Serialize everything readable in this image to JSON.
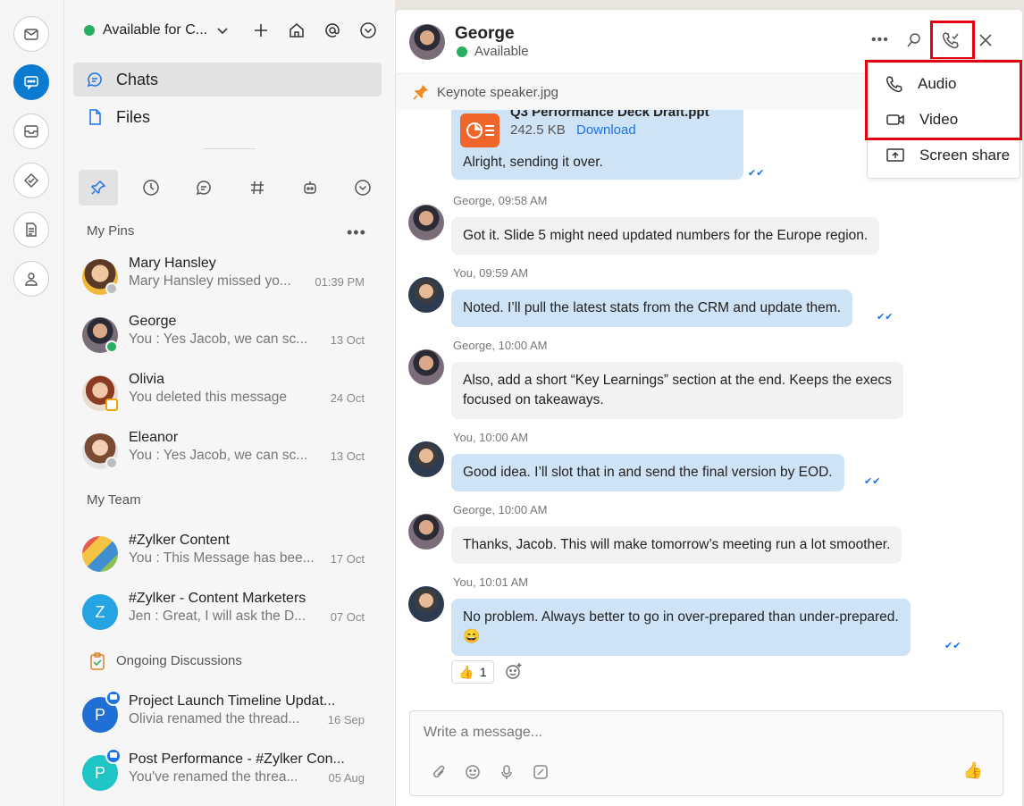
{
  "rail": {
    "items": [
      "mail-icon",
      "chat-icon",
      "inbox-icon",
      "tasks-icon",
      "notes-icon",
      "contacts-icon"
    ]
  },
  "status": {
    "label": "Available for C...",
    "color": "#27ae60"
  },
  "nav": {
    "chats": "Chats",
    "files": "Files"
  },
  "sections": {
    "pins": "My Pins",
    "team": "My Team",
    "discussions": "Ongoing Discussions"
  },
  "pins": [
    {
      "name": "Mary Hansley",
      "preview": "Mary  Hansley missed yo...",
      "time": "01:39 PM",
      "presence": "#bdbdbd"
    },
    {
      "name": "George",
      "preview": "You : Yes Jacob, we can sc...",
      "time": "13 Oct",
      "presence": "#27ae60"
    },
    {
      "name": "Olivia",
      "preview": "You deleted this message",
      "time": "24 Oct",
      "presence": "#f0a500"
    },
    {
      "name": "Eleanor",
      "preview": "You : Yes Jacob, we can sc...",
      "time": "13 Oct",
      "presence": "#bdbdbd"
    }
  ],
  "team": [
    {
      "name": "#Zylker Content",
      "preview": "You : This Message has bee...",
      "time": "17 Oct"
    },
    {
      "name": "#Zylker - Content Marketers",
      "preview": "Jen : Great, I will ask the D...",
      "time": "07 Oct",
      "initial": "Z"
    }
  ],
  "discussions": [
    {
      "name": "Project Launch Timeline Updat...",
      "preview": "Olivia renamed the thread...",
      "time": "16 Sep",
      "initial": "P"
    },
    {
      "name": "Post Performance - #Zylker Con...",
      "preview": "You've renamed the threa...",
      "time": "05 Aug",
      "initial": "P"
    }
  ],
  "conversation": {
    "name": "George",
    "status": "Available",
    "pinned": "Keynote speaker.jpg",
    "file": {
      "name": "Q3 Performance Deck Draft.ppt",
      "size": "242.5 KB",
      "download": "Download",
      "caption": "Alright, sending it over."
    },
    "messages": [
      {
        "meta": "George, 09:58 AM",
        "text": "Got it. Slide 5 might need updated numbers for the Europe region."
      },
      {
        "meta": "You, 09:59 AM",
        "text": "Noted. I’ll pull the latest stats from the CRM and update them."
      },
      {
        "meta": "George, 10:00 AM",
        "line1": "Also, add a short “Key Learnings” section at the end. Keeps the execs",
        "line2": "focused on takeaways."
      },
      {
        "meta": "You, 10:00 AM",
        "text": "Good idea. I’ll slot that in and send the final version by EOD."
      },
      {
        "meta": "George, 10:00 AM",
        "text": "Thanks, Jacob. This will make tomorrow’s meeting run a lot smoother."
      },
      {
        "meta": "You, 10:01 AM",
        "line1": "No problem. Always better to go in over-prepared than under-prepared.",
        "line2": "😄"
      }
    ],
    "reaction": {
      "emoji": "👍",
      "count": "1"
    },
    "composer_placeholder": "Write a message..."
  },
  "call_menu": {
    "audio": "Audio",
    "video": "Video",
    "screen": "Screen share"
  }
}
